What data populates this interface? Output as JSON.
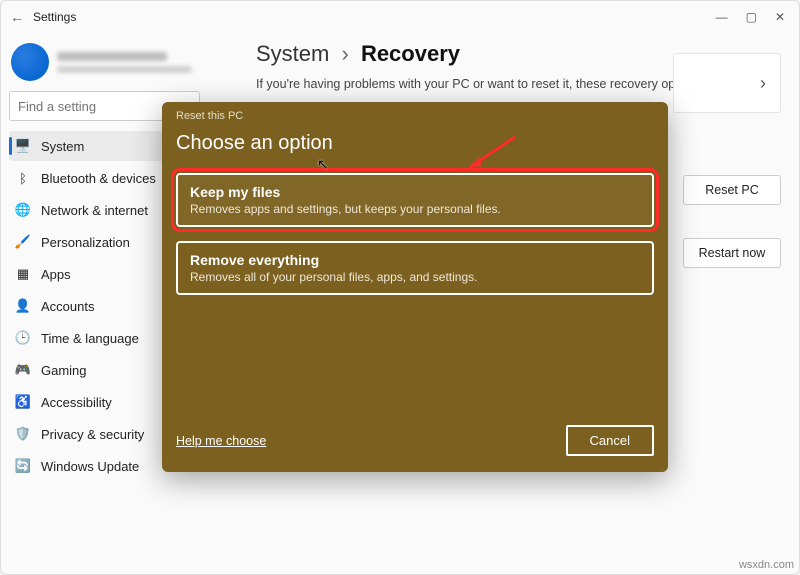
{
  "window": {
    "title": "Settings"
  },
  "search": {
    "placeholder": "Find a setting"
  },
  "sidebar": {
    "items": [
      {
        "icon": "🖥️",
        "label": "System",
        "name": "sidebar-item-system",
        "selected": true
      },
      {
        "icon": "ᛒ",
        "label": "Bluetooth & devices",
        "name": "sidebar-item-bluetooth"
      },
      {
        "icon": "🌐",
        "label": "Network & internet",
        "name": "sidebar-item-network"
      },
      {
        "icon": "🖌️",
        "label": "Personalization",
        "name": "sidebar-item-personalization"
      },
      {
        "icon": "▦",
        "label": "Apps",
        "name": "sidebar-item-apps"
      },
      {
        "icon": "👤",
        "label": "Accounts",
        "name": "sidebar-item-accounts"
      },
      {
        "icon": "🕒",
        "label": "Time & language",
        "name": "sidebar-item-time"
      },
      {
        "icon": "🎮",
        "label": "Gaming",
        "name": "sidebar-item-gaming"
      },
      {
        "icon": "♿",
        "label": "Accessibility",
        "name": "sidebar-item-accessibility"
      },
      {
        "icon": "🛡️",
        "label": "Privacy & security",
        "name": "sidebar-item-privacy"
      },
      {
        "icon": "🔄",
        "label": "Windows Update",
        "name": "sidebar-item-update"
      }
    ]
  },
  "breadcrumb": {
    "root": "System",
    "current": "Recovery"
  },
  "help": "If you're having problems with your PC or want to reset it, these recovery options might help.",
  "buttons": {
    "reset": "Reset PC",
    "restart": "Restart now"
  },
  "dialog": {
    "header": "Reset this PC",
    "title": "Choose an option",
    "options": [
      {
        "title": "Keep my files",
        "desc": "Removes apps and settings, but keeps your personal files.",
        "highlight": true
      },
      {
        "title": "Remove everything",
        "desc": "Removes all of your personal files, apps, and settings.",
        "highlight": false
      }
    ],
    "help_link": "Help me choose",
    "cancel": "Cancel"
  },
  "watermark": "wsxdn.com"
}
